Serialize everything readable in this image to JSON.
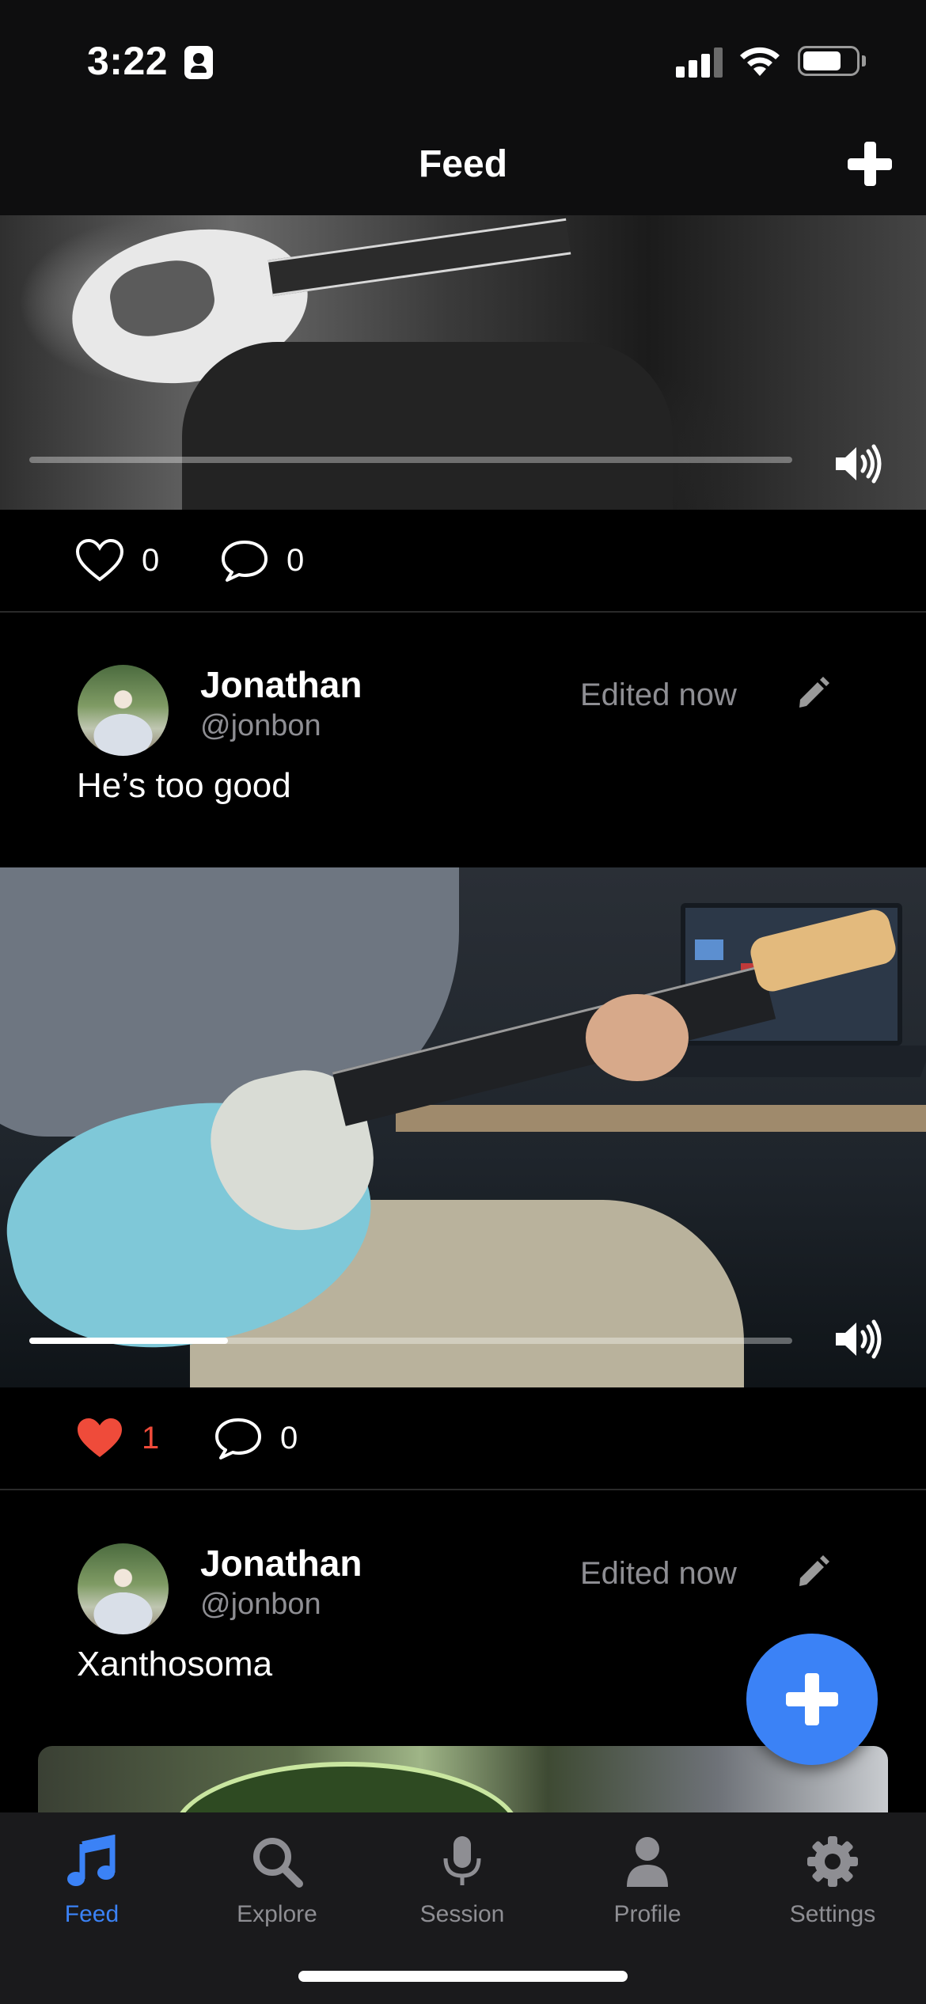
{
  "status_bar": {
    "time": "3:22"
  },
  "header": {
    "title": "Feed"
  },
  "posts": [
    {
      "likes": "0",
      "comments": "0",
      "liked": false,
      "video_progress": 0
    },
    {
      "author_name": "Jonathan",
      "author_handle": "@jonbon",
      "edited": "Edited now",
      "text": "He’s too good",
      "likes": "1",
      "comments": "0",
      "liked": true,
      "video_progress": 0.26
    },
    {
      "author_name": "Jonathan",
      "author_handle": "@jonbon",
      "edited": "Edited now",
      "text": "Xanthosoma"
    }
  ],
  "tabs": [
    {
      "label": "Feed",
      "icon": "music-note-icon",
      "active": true
    },
    {
      "label": "Explore",
      "icon": "search-icon",
      "active": false
    },
    {
      "label": "Session",
      "icon": "microphone-icon",
      "active": false
    },
    {
      "label": "Profile",
      "icon": "person-icon",
      "active": false
    },
    {
      "label": "Settings",
      "icon": "gear-icon",
      "active": false
    }
  ],
  "colors": {
    "accent": "#3b82f6",
    "like": "#ef4b3a",
    "muted": "#8e8e93"
  }
}
